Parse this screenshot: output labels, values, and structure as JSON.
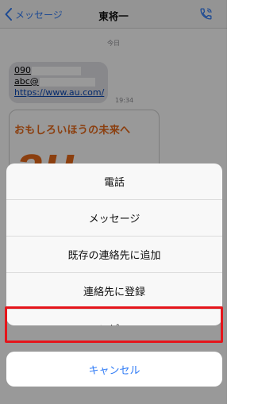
{
  "navbar": {
    "back_label": "メッセージ",
    "title": "東将一"
  },
  "chat": {
    "date_label": "今日",
    "bubble": {
      "line1": "090",
      "line2": "abc@",
      "line3": "https://www.au.com/"
    },
    "time": "19:34",
    "promo_text": "おもしろいほうの未来へ",
    "promo_logo_text": "au"
  },
  "action_sheet": {
    "items": [
      {
        "label": "電話"
      },
      {
        "label": "メッセージ"
      },
      {
        "label": "既存の連絡先に追加"
      },
      {
        "label": "連絡先に登録"
      },
      {
        "label": "コピー"
      }
    ],
    "cancel_label": "キャンセル"
  },
  "colors": {
    "accent": "#2f7bf6",
    "highlight": "#e5151b",
    "promo_orange": "#e8691a"
  }
}
